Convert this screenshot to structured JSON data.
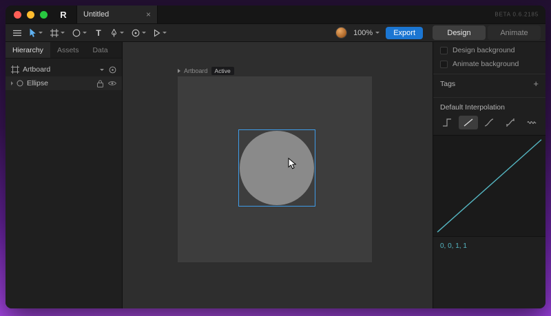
{
  "titlebar": {
    "logo_letter": "R",
    "tab_title": "Untitled",
    "close_glyph": "×",
    "beta_label": "BETA 0.6.2185"
  },
  "toolbar": {
    "text_tool_glyph": "T",
    "zoom_value": "100%",
    "export_label": "Export",
    "design_label": "Design",
    "animate_label": "Animate"
  },
  "hierarchy_panel": {
    "tabs": [
      {
        "label": "Hierarchy"
      },
      {
        "label": "Assets"
      },
      {
        "label": "Data"
      }
    ],
    "items": [
      {
        "label": "Artboard"
      },
      {
        "label": "Ellipse"
      }
    ]
  },
  "canvas": {
    "artboard_label": "Artboard",
    "active_badge": "Active"
  },
  "inspector": {
    "design_bg_label": "Design background",
    "animate_bg_label": "Animate background",
    "tags_title": "Tags",
    "tags_add_glyph": "+",
    "interpolation_title": "Default Interpolation",
    "curve_values": "0, 0, 1, 1"
  },
  "colors": {
    "selection_blue": "#3f9ce8",
    "tool_blue": "#5fb2f2",
    "export_blue": "#1b76d2",
    "curve_teal": "#55b6c2"
  }
}
